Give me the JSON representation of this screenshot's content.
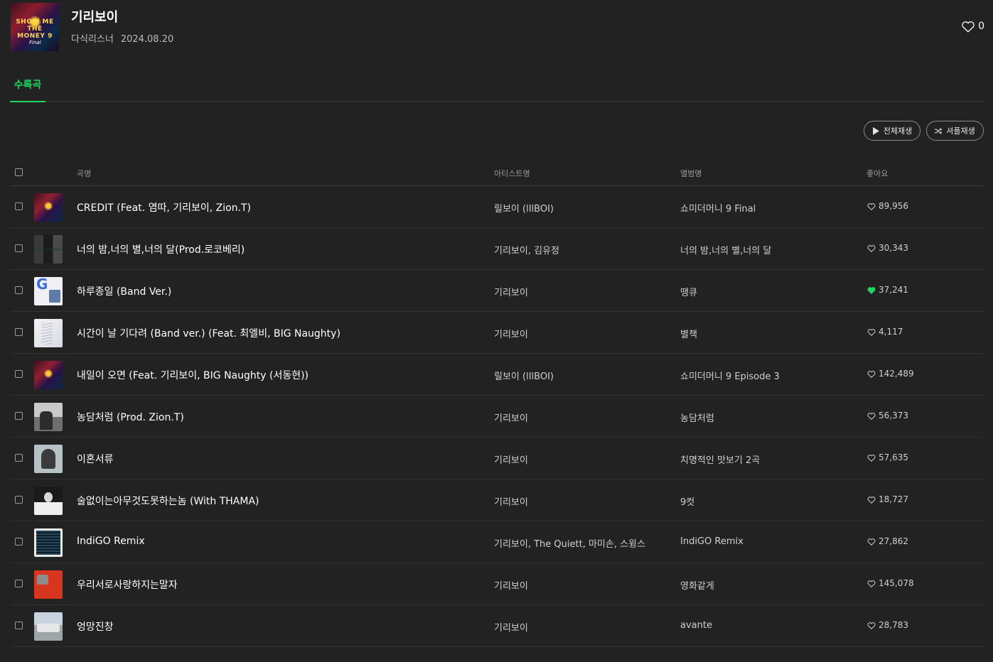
{
  "album": {
    "title": "기리보이",
    "agency": "다식리스너",
    "date": "2024.08.20",
    "like_count": "0",
    "cover_label": "SHOW ME THE MONEY 9",
    "cover_sub": "Final"
  },
  "tabs": {
    "active": "수록곡"
  },
  "buttons": {
    "play_all": "전체재생",
    "shuffle": "셔플재생"
  },
  "columns": {
    "song": "곡명",
    "artist": "아티스트명",
    "album": "앨범명",
    "likes": "좋아요"
  },
  "colors": {
    "accent": "#1ed760",
    "background": "#222222"
  },
  "tracks": [
    {
      "song": "CREDIT (Feat. 염따, 기리보이, Zion.T)",
      "artist": "릴보이 (lIlBOI)",
      "album": "쇼미더머니 9 Final",
      "likes": "89,956",
      "liked": false,
      "thumb_icon": "smtm-cover"
    },
    {
      "song": "너의 밤,너의 별,너의 달(Prod.로코베리)",
      "artist": "기리보이, 김유정",
      "album": "너의 밤,너의 별,너의 달",
      "likes": "30,343",
      "liked": false,
      "thumb_icon": "night-cover"
    },
    {
      "song": "하루종일 (Band Ver.)",
      "artist": "기리보이",
      "album": "땡큐",
      "likes": "37,241",
      "liked": true,
      "thumb_icon": "thankyou-cover"
    },
    {
      "song": "시간이 날 기다려 (Band ver.) (Feat. 최엘비, BIG Naughty)",
      "artist": "기리보이",
      "album": "별책",
      "likes": "4,117",
      "liked": false,
      "thumb_icon": "byeolchaek-cover"
    },
    {
      "song": "내일이 오면 (Feat. 기리보이, BIG Naughty (서동현))",
      "artist": "릴보이 (lIlBOI)",
      "album": "쇼미더머니 9 Episode 3",
      "likes": "142,489",
      "liked": false,
      "thumb_icon": "smtm-cover"
    },
    {
      "song": "농담처럼 (Prod. Zion.T)",
      "artist": "기리보이",
      "album": "농담처럼",
      "likes": "56,373",
      "liked": false,
      "thumb_icon": "joke-cover"
    },
    {
      "song": "이혼서류",
      "artist": "기리보이",
      "album": "치명적인 맛보기 2곡",
      "likes": "57,635",
      "liked": false,
      "thumb_icon": "divorce-cover"
    },
    {
      "song": "술없이는아무것도못하는놈 (With THAMA)",
      "artist": "기리보이",
      "album": "9컷",
      "likes": "18,727",
      "liked": false,
      "thumb_icon": "9cut-cover"
    },
    {
      "song": "IndiGO Remix",
      "artist": "기리보이, The Quiett, 마미손, 스윙스",
      "album": "IndiGO Remix",
      "likes": "27,862",
      "liked": false,
      "thumb_icon": "indigo-cover"
    },
    {
      "song": "우리서로사랑하지는말자",
      "artist": "기리보이",
      "album": "영화같게",
      "likes": "145,078",
      "liked": false,
      "thumb_icon": "movie-cover"
    },
    {
      "song": "엉망진창",
      "artist": "기리보이",
      "album": "avante",
      "likes": "28,783",
      "liked": false,
      "thumb_icon": "avante-cover"
    }
  ]
}
